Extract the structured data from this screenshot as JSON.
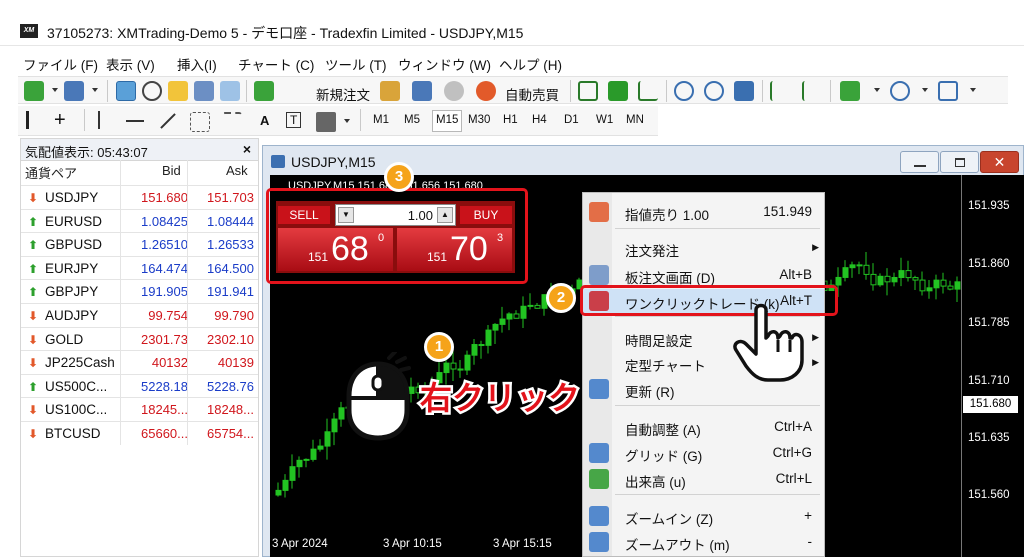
{
  "window": {
    "title": "37105273: XMTrading-Demo 5 - デモ口座 - Tradexfin Limited - USDJPY,M15",
    "logo": "XM"
  },
  "menu": [
    "ファイル (F)",
    "表示 (V)",
    "挿入(I)",
    "チャート (C)",
    "ツール (T)",
    "ウィンドウ (W)",
    "ヘルプ (H)"
  ],
  "toolbar": {
    "new_order": "新規注文",
    "autotrade": "自動売買"
  },
  "timeframes": [
    "M1",
    "M5",
    "M15",
    "M30",
    "H1",
    "H4",
    "D1",
    "W1",
    "MN"
  ],
  "drawing_tools": {
    "text": "A",
    "label": "T"
  },
  "market_watch": {
    "title": "気配値表示: 05:43:07",
    "close": "×",
    "col_symbol": "通貨ペア",
    "col_bid": "Bid",
    "col_ask": "Ask",
    "rows": [
      {
        "symbol": "USDJPY",
        "bid": "151.680",
        "ask": "151.703",
        "dir": "down"
      },
      {
        "symbol": "EURUSD",
        "bid": "1.08425",
        "ask": "1.08444",
        "dir": "up"
      },
      {
        "symbol": "GBPUSD",
        "bid": "1.26510",
        "ask": "1.26533",
        "dir": "up"
      },
      {
        "symbol": "EURJPY",
        "bid": "164.474",
        "ask": "164.500",
        "dir": "up"
      },
      {
        "symbol": "GBPJPY",
        "bid": "191.905",
        "ask": "191.941",
        "dir": "up"
      },
      {
        "symbol": "AUDJPY",
        "bid": "99.754",
        "ask": "99.790",
        "dir": "down"
      },
      {
        "symbol": "GOLD",
        "bid": "2301.73",
        "ask": "2302.10",
        "dir": "down"
      },
      {
        "symbol": "JP225Cash",
        "bid": "40132",
        "ask": "40139",
        "dir": "down"
      },
      {
        "symbol": "US500C...",
        "bid": "5228.18",
        "ask": "5228.76",
        "dir": "up"
      },
      {
        "symbol": "US100C...",
        "bid": "18245...",
        "ask": "18248...",
        "dir": "down"
      },
      {
        "symbol": "BTCUSD",
        "bid": "65660...",
        "ask": "65754...",
        "dir": "down"
      }
    ]
  },
  "chart": {
    "title": "USDJPY,M15",
    "info": "USDJPY,M15  151.687 151.656 151.680",
    "y_labels": [
      "151.935",
      "151.860",
      "151.785",
      "151.710",
      "151.635",
      "151.560"
    ],
    "current_price": "151.680",
    "x_labels": [
      "3 Apr 2024",
      "3 Apr 10:15",
      "3 Apr 15:15"
    ]
  },
  "one_click": {
    "sell": "SELL",
    "buy": "BUY",
    "lot": "1.00",
    "sell_small": "151",
    "sell_big": "68",
    "sell_sup": "0",
    "buy_small": "151",
    "buy_big": "70",
    "buy_sup": "3"
  },
  "context_menu": [
    {
      "label": "指値売り 1.00",
      "shortcut": "151.949",
      "icon": "sell-limit-icon"
    },
    {
      "label": "注文発注",
      "submenu": true
    },
    {
      "label": "板注文画面 (D)",
      "shortcut": "Alt+B",
      "icon": "depth-of-market-icon"
    },
    {
      "label": "ワンクリックトレード (k)",
      "shortcut": "Alt+T",
      "icon": "one-click-trading-icon",
      "highlighted": true
    },
    {
      "label": "時間足設定",
      "submenu": true
    },
    {
      "label": "定型チャート",
      "submenu": true
    },
    {
      "label": "更新 (R)",
      "icon": "refresh-icon"
    },
    {
      "label": "自動調整 (A)",
      "shortcut": "Ctrl+A"
    },
    {
      "label": "グリッド (G)",
      "shortcut": "Ctrl+G",
      "icon": "grid-icon"
    },
    {
      "label": "出来高 (u)",
      "shortcut": "Ctrl+L",
      "icon": "volumes-icon"
    },
    {
      "label": "ズームイン (Z)",
      "shortcut": "+",
      "icon": "zoom-in-icon"
    },
    {
      "label": "ズームアウト (m)",
      "shortcut": "-",
      "icon": "zoom-out-icon"
    }
  ],
  "annotations": {
    "step1": "1",
    "step2": "2",
    "step3": "3",
    "right_click": "右クリック"
  },
  "colors": {
    "bid_down": "#d0161c",
    "bid_up": "#1a3cc8",
    "candle": "#22c322",
    "highlight_box": "#e3131b",
    "badge": "#f5a31a"
  }
}
